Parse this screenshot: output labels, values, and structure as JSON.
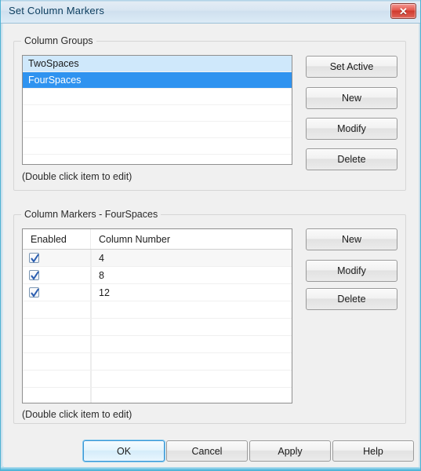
{
  "window": {
    "title": "Set Column Markers",
    "close_label": "✕"
  },
  "groups_section": {
    "legend": "Column Groups",
    "hint": "(Double click item to edit)",
    "items": [
      {
        "label": "TwoSpaces",
        "state": "hot"
      },
      {
        "label": "FourSpaces",
        "state": "active"
      }
    ],
    "buttons": {
      "set_active": "Set Active",
      "new": "New",
      "modify": "Modify",
      "delete": "Delete"
    }
  },
  "markers_section": {
    "legend": "Column Markers - FourSpaces",
    "hint": "(Double click item to edit)",
    "columns": {
      "enabled": "Enabled",
      "number": "Column Number"
    },
    "rows": [
      {
        "enabled": true,
        "number": "4"
      },
      {
        "enabled": true,
        "number": "8"
      },
      {
        "enabled": true,
        "number": "12"
      }
    ],
    "buttons": {
      "new": "New",
      "modify": "Modify",
      "delete": "Delete"
    }
  },
  "footer": {
    "ok": "OK",
    "cancel": "Cancel",
    "apply": "Apply",
    "help": "Help"
  },
  "colors": {
    "selection": "#2f93f0",
    "hover": "#cfe8fb",
    "title_text": "#0b3c5d",
    "close_button": "#cf3a2e",
    "focus_ring": "#7ec8ef"
  }
}
